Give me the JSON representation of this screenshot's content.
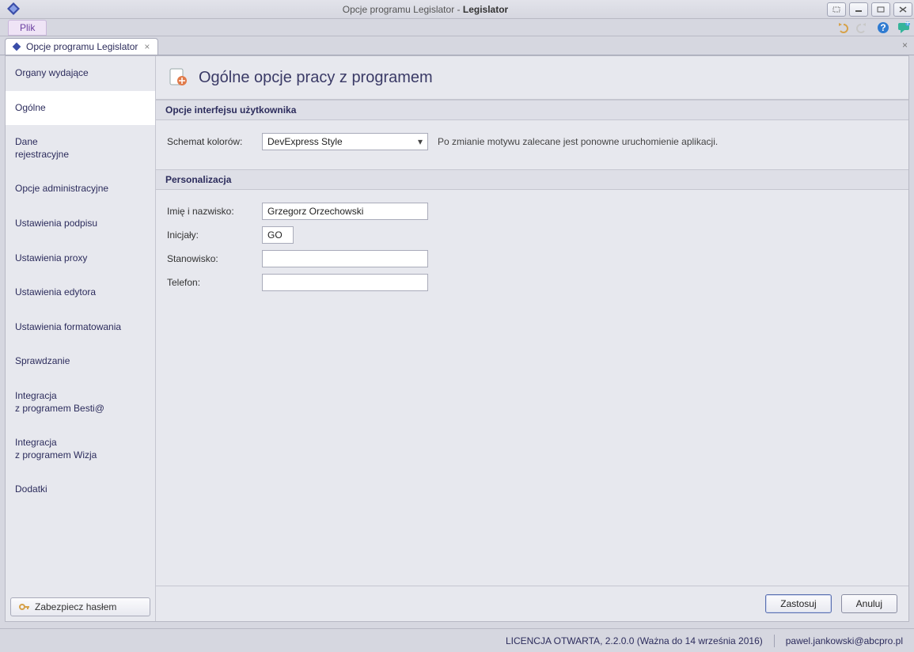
{
  "window": {
    "title_prefix": "Opcje programu Legislator - ",
    "title_app": "Legislator"
  },
  "menu": {
    "plik": "Plik"
  },
  "tab": {
    "label": "Opcje programu Legislator"
  },
  "sidebar": {
    "items": [
      "Organy wydające",
      "Ogólne",
      "Dane\nrejestracyjne",
      "Opcje administracyjne",
      "Ustawienia podpisu",
      "Ustawienia proxy",
      "Ustawienia edytora",
      "Ustawienia formatowania",
      "Sprawdzanie",
      "Integracja\nz programem Besti@",
      "Integracja\nz programem Wizja",
      "Dodatki"
    ],
    "active_index": 1,
    "secure_button": "Zabezpiecz hasłem"
  },
  "page": {
    "title": "Ogólne opcje pracy z programem",
    "section_ui": "Opcje interfejsu użytkownika",
    "section_personal": "Personalizacja",
    "scheme_label": "Schemat kolorów:",
    "scheme_value": "DevExpress Style",
    "scheme_hint": "Po zmianie motywu zalecane jest ponowne uruchomienie aplikacji.",
    "name_label": "Imię i nazwisko:",
    "name_value": "Grzegorz Orzechowski",
    "initials_label": "Inicjały:",
    "initials_value": "GO",
    "position_label": "Stanowisko:",
    "position_value": "",
    "phone_label": "Telefon:",
    "phone_value": ""
  },
  "buttons": {
    "apply": "Zastosuj",
    "cancel": "Anuluj"
  },
  "status": {
    "license": "LICENCJA OTWARTA, 2.2.0.0 (Ważna do 14 września 2016)",
    "user": "pawel.jankowski@abcpro.pl"
  }
}
